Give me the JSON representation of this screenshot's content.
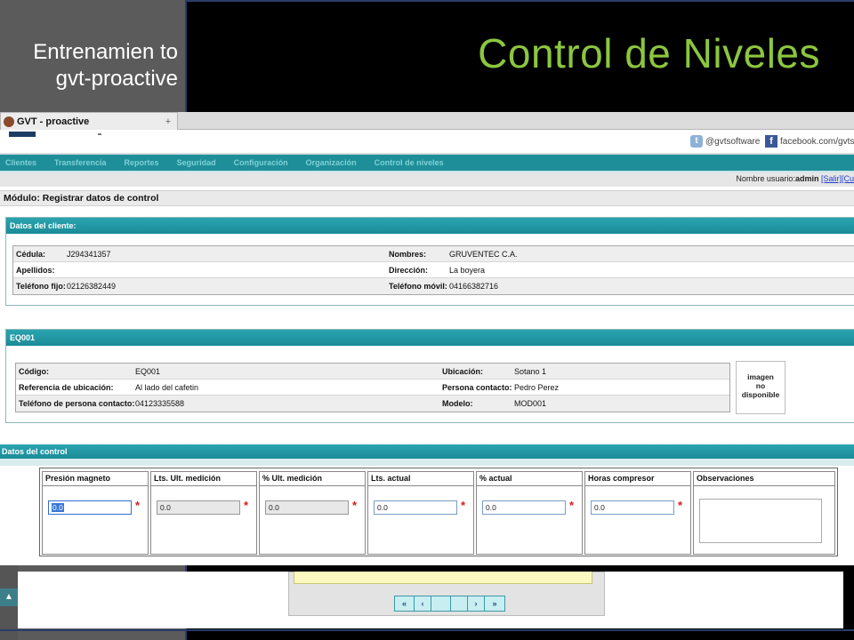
{
  "slide": {
    "left_title": "Entrenamien to gvt-proactive",
    "title": "Control de Niveles"
  },
  "browser": {
    "tab_title": "GVT - proactive",
    "new_tab": "+"
  },
  "social": {
    "twitter": "@gvtsoftware",
    "facebook": "facebook.com/gvtsofw"
  },
  "nav": {
    "items": [
      "Clientes",
      "Transferencia",
      "Reportes",
      "Seguridad",
      "Configuración",
      "Organización",
      "Control de niveles"
    ]
  },
  "user": {
    "label": "Nombre usuario:",
    "name": "admin",
    "salir": "[Salir]",
    "cuenta": "[Cu"
  },
  "module": {
    "title": "Módulo: Registrar datos de control"
  },
  "client": {
    "header": "Datos del cliente:",
    "rows": [
      {
        "l1": "Cédula:",
        "v1": "J294341357",
        "l2": "Nombres:",
        "v2": "GRUVENTEC C.A."
      },
      {
        "l1": "Apellidos:",
        "v1": "",
        "l2": "Dirección:",
        "v2": "La boyera"
      },
      {
        "l1": "Teléfono fijo:",
        "v1": "02126382449",
        "l2": "Teléfono móvil:",
        "v2": "04166382716"
      }
    ]
  },
  "equipment": {
    "header": "EQ001",
    "rows": [
      {
        "l1": "Código:",
        "v1": "EQ001",
        "l2": "Ubicación:",
        "v2": "Sotano 1"
      },
      {
        "l1": "Referencia de ubicación:",
        "v1": "Al lado del cafetin",
        "l2": "Persona contacto:",
        "v2": "Pedro Perez"
      },
      {
        "l1": "Teléfono de persona contacto:",
        "v1": "04123335588",
        "l2": "Modelo:",
        "v2": "MOD001"
      }
    ],
    "image_placeholder": [
      "imagen",
      "no",
      "disponible"
    ]
  },
  "control": {
    "header": "Datos del control",
    "columns": [
      {
        "label": "Presión magneto",
        "value": "0.0",
        "required": "*"
      },
      {
        "label": "Lts. Ult. medición",
        "value": "0.0",
        "required": "*"
      },
      {
        "label": "% Ult. medición",
        "value": "0.0",
        "required": "*"
      },
      {
        "label": "Lts. actual",
        "value": "0.0",
        "required": "*"
      },
      {
        "label": "% actual",
        "value": "0.0",
        "required": "*"
      },
      {
        "label": "Horas compresor",
        "value": "0.0",
        "required": "*"
      },
      {
        "label": "Observaciones",
        "value": ""
      }
    ]
  },
  "pager": {
    "first": "«",
    "prev": "‹",
    "next": "›",
    "last": "»"
  }
}
